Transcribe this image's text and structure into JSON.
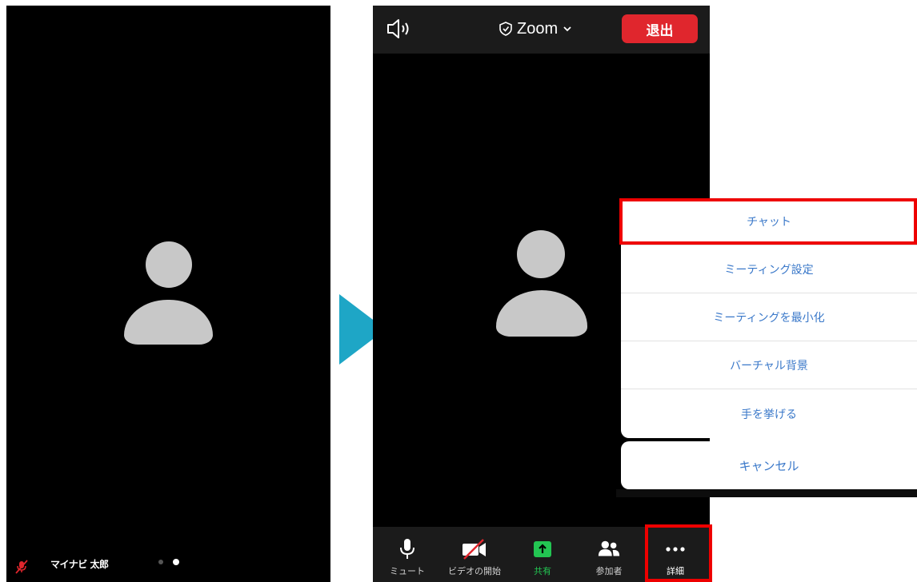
{
  "left_phone": {
    "user_name": "マイナビ 太郎",
    "page_dots": 2,
    "active_dot": 2
  },
  "right_phone": {
    "header": {
      "speaker_icon": "speaker-icon",
      "title": "Zoom",
      "leave_label": "退出",
      "leave_color": "#e0262d"
    },
    "toolbar": {
      "mute_label": "ミュート",
      "video_label": "ビデオの開始",
      "share_label": "共有",
      "participants_label": "参加者",
      "more_label": "詳細",
      "share_color": "#23c552"
    }
  },
  "menu": {
    "items": [
      {
        "label": "チャット"
      },
      {
        "label": "ミーティング設定"
      },
      {
        "label": "ミーティングを最小化"
      },
      {
        "label": "バーチャル背景"
      },
      {
        "label": "手を挙げる"
      }
    ],
    "cancel_label": "キャンセル",
    "text_color": "#3a78c9"
  },
  "annotations": {
    "highlight_color": "#ee0000",
    "arrow_color": "#1ea6c6"
  }
}
